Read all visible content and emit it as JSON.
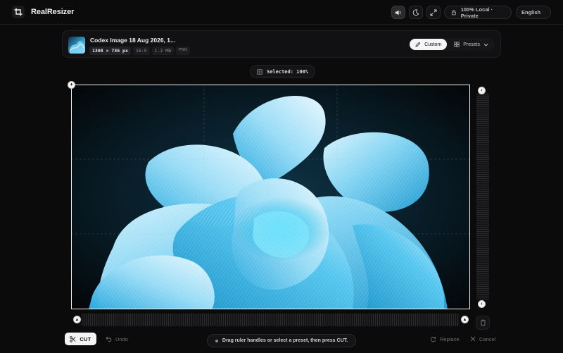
{
  "app": {
    "name": "RealResizer"
  },
  "topbar": {
    "local_label": "100% Local · Private",
    "language": "English",
    "icons": [
      "sound-icon",
      "moon-icon",
      "expand-icon",
      "lock-icon",
      "chevron-down-icon"
    ]
  },
  "file": {
    "name": "Codex Image 18 Aug 2026, 1...",
    "dimensions": "1308 × 736 px",
    "aspect": "16:9",
    "size": "1.2 MB",
    "format": "PNG"
  },
  "mode": {
    "custom": "Custom",
    "presets": "Presets",
    "selected": "Custom"
  },
  "selection": {
    "label": "Selected: 100%"
  },
  "bottom": {
    "cut": "CUT",
    "undo": "Undo",
    "hint": "Drag ruler handles or select a preset, then press CUT.",
    "replace": "Replace",
    "cancel": "Cancel"
  },
  "colors": {
    "accent": "#f4f4f5",
    "background": "#0b0b0c",
    "artwork_primary": "#4cc3ee"
  }
}
